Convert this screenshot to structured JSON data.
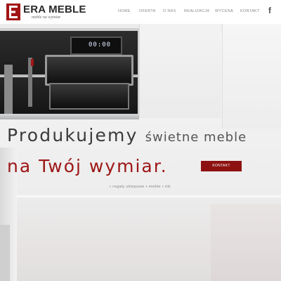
{
  "header": {
    "logo_title_prefix": "E",
    "logo_title_rest": "ERA MEBLE",
    "logo_subtitle": "meble na wymiar",
    "nav": [
      {
        "label": "HOME"
      },
      {
        "label": "OFERTA"
      },
      {
        "label": "O NAS"
      },
      {
        "label": "REALIZACJA"
      },
      {
        "label": "WYCENA"
      },
      {
        "label": "KONTAKT"
      }
    ],
    "social_icon": "facebook-icon",
    "social_glyph": "f"
  },
  "oven": {
    "display_text": "00:00"
  },
  "hero": {
    "line1_big": "Produkujemy",
    "line1_small": "świetne meble",
    "line2": "na Twój wymiar.",
    "button_label": "KONTAKT",
    "tagline": "• regały sklepowe • meble • itd."
  },
  "colors": {
    "accent": "#9d1515",
    "button": "#8d1111",
    "text_dark": "#3a3a3a"
  }
}
